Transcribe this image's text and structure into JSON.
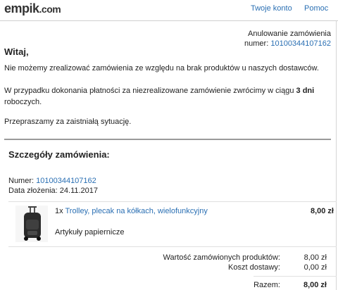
{
  "header": {
    "logo": "empik",
    "logo_suffix": ".com",
    "account_link": "Twoje konto",
    "help_link": "Pomoc"
  },
  "status": {
    "title": "Anulowanie zamówienia",
    "order_label": "numer:",
    "order_number": "10100344107162"
  },
  "message": {
    "greeting": "Witaj,",
    "p1": "Nie możemy zrealizować zamówienia ze względu na brak produktów u naszych dostawców.",
    "p2_before": "W przypadku dokonania płatności za niezrealizowane zamówienie zwrócimy w ciągu ",
    "p2_bold": "3 dni",
    "p2_after": " roboczych.",
    "p3": "Przepraszamy za zaistniałą sytuację."
  },
  "details": {
    "title": "Szczegóły zamówienia:",
    "number_label": "Numer:",
    "number_value": "10100344107162",
    "date_label": "Data złożenia:",
    "date_value": "24.11.2017"
  },
  "items": [
    {
      "qty": "1x",
      "name": "Trolley, plecak na kółkach, wielofunkcyjny",
      "category": "Artykuły papiernicze",
      "price": "8,00 zł"
    }
  ],
  "summary": {
    "products_label": "Wartość zamówionych produktów:",
    "products_value": "8,00 zł",
    "shipping_label": "Koszt dostawy:",
    "shipping_value": "0,00 zł",
    "total_label": "Razem:",
    "total_value": "8,00 zł"
  },
  "colors": {
    "link": "#2a6fb3",
    "separator": "#9a9a9a"
  }
}
